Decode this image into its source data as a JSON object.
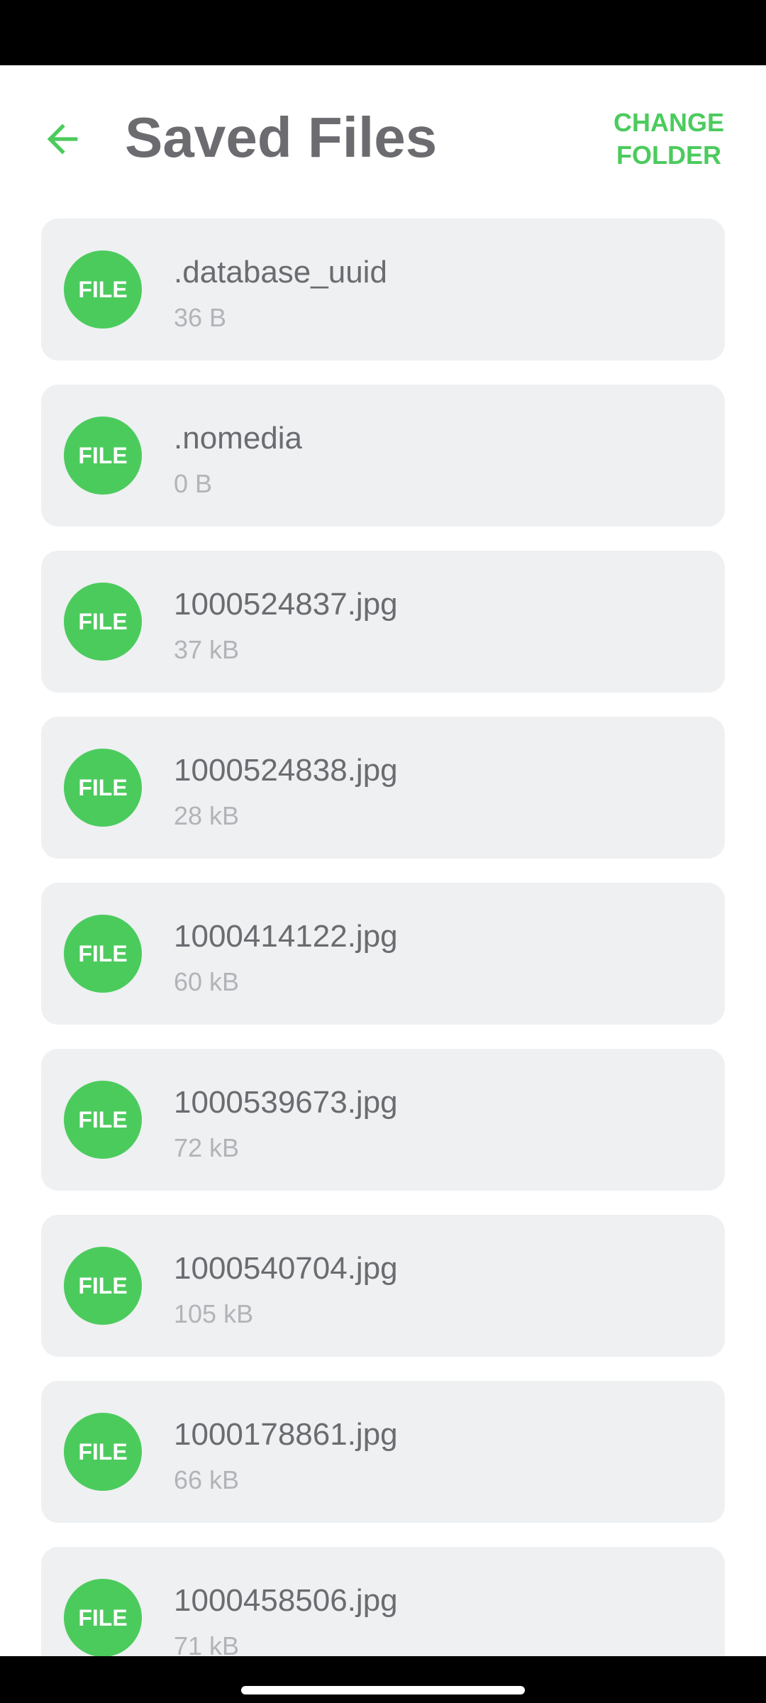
{
  "app_bar": {
    "title": "Saved Files",
    "back_icon": "arrow-left-icon",
    "change_folder_label": "CHANGE\nFOLDER",
    "accent_color": "#4ccb5d"
  },
  "files": [
    {
      "badge": "FILE",
      "name": ".database_uuid",
      "size": "36 B"
    },
    {
      "badge": "FILE",
      "name": ".nomedia",
      "size": "0 B"
    },
    {
      "badge": "FILE",
      "name": "1000524837.jpg",
      "size": "37 kB"
    },
    {
      "badge": "FILE",
      "name": "1000524838.jpg",
      "size": "28 kB"
    },
    {
      "badge": "FILE",
      "name": "1000414122.jpg",
      "size": "60 kB"
    },
    {
      "badge": "FILE",
      "name": "1000539673.jpg",
      "size": "72 kB"
    },
    {
      "badge": "FILE",
      "name": "1000540704.jpg",
      "size": "105 kB"
    },
    {
      "badge": "FILE",
      "name": "1000178861.jpg",
      "size": "66 kB"
    },
    {
      "badge": "FILE",
      "name": "1000458506.jpg",
      "size": "71 kB"
    }
  ]
}
